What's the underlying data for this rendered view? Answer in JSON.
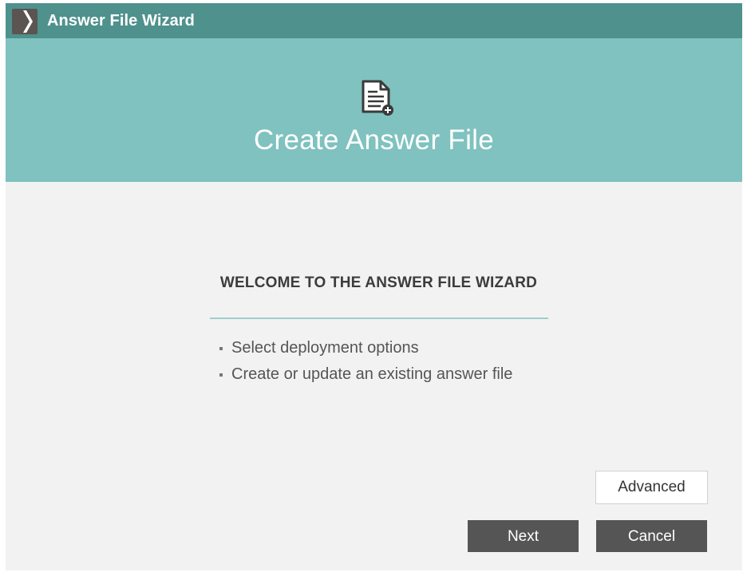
{
  "window": {
    "title": "Answer File Wizard",
    "titlebar_color": "#4f918c",
    "banner_color": "#7fc2bf",
    "logo_icon": "chevron-logo-icon",
    "banner_icon": "document-add-icon"
  },
  "banner": {
    "title": "Create Answer File"
  },
  "content": {
    "heading": "WELCOME TO THE ANSWER FILE WIZARD",
    "bullets": [
      "Select deployment options",
      "Create or update an existing answer file"
    ]
  },
  "buttons": {
    "advanced": "Advanced",
    "next": "Next",
    "cancel": "Cancel"
  }
}
